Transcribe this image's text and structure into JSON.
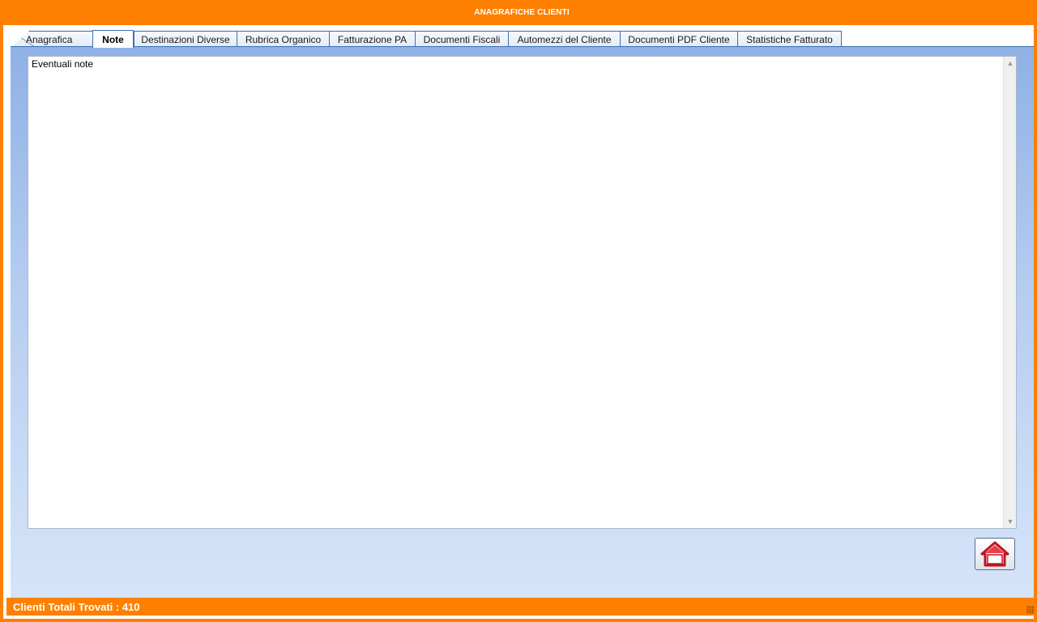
{
  "window": {
    "title": "ANAGRAFICHE CLIENTI",
    "accent_color": "#ff8000",
    "tab_border_color": "#3b6fb4"
  },
  "tabs": [
    {
      "label": "Anagrafica",
      "active": false
    },
    {
      "label": "Note",
      "active": true
    },
    {
      "label": "Destinazioni Diverse",
      "active": false
    },
    {
      "label": "Rubrica Organico",
      "active": false
    },
    {
      "label": "Fatturazione PA",
      "active": false
    },
    {
      "label": "Documenti Fiscali",
      "active": false
    },
    {
      "label": "Automezzi del Cliente",
      "active": false
    },
    {
      "label": "Documenti PDF Cliente",
      "active": false
    },
    {
      "label": "Statistiche Fatturato",
      "active": false
    }
  ],
  "notes": {
    "text": "Eventuali note"
  },
  "home_button": {
    "icon": "home-icon"
  },
  "status": {
    "text": "Clienti Totali Trovati : 410"
  }
}
